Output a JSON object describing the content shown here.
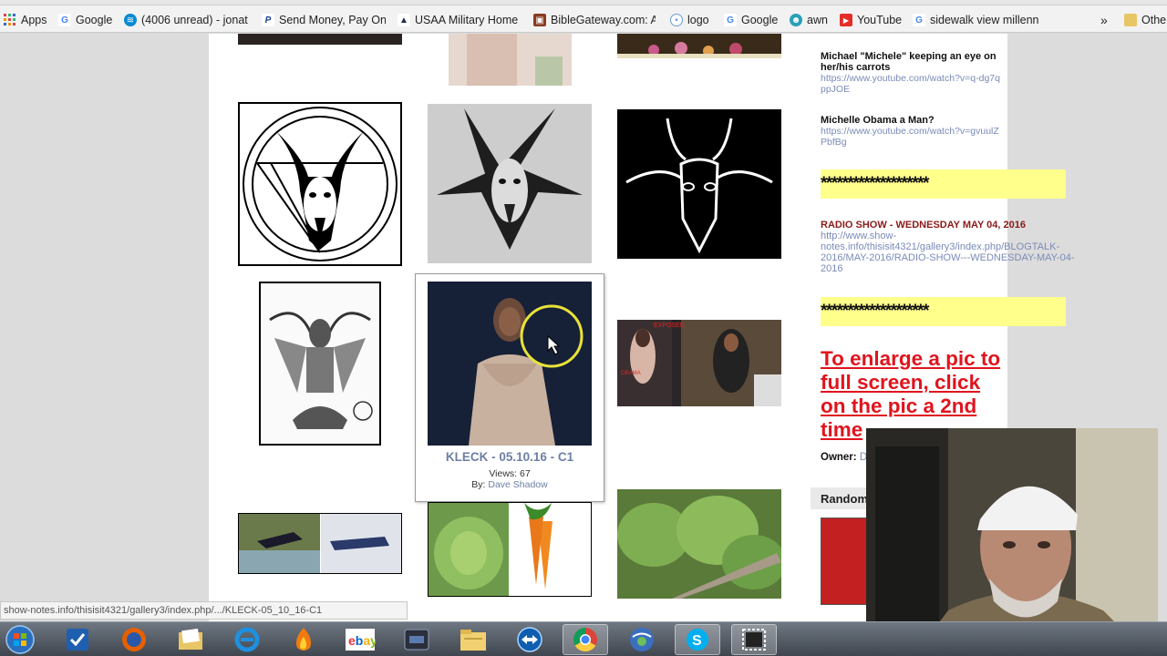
{
  "bookmarks": {
    "apps_label": "Apps",
    "items": [
      {
        "label": "Google",
        "icon": "google-icon"
      },
      {
        "label": "(4006 unread) - jonat",
        "icon": "att-icon"
      },
      {
        "label": "Send Money, Pay Onl",
        "icon": "paypal-icon"
      },
      {
        "label": "USAA Military Home",
        "icon": "usaa-icon"
      },
      {
        "label": "BibleGateway.com: A",
        "icon": "biblegateway-icon"
      },
      {
        "label": "logo",
        "icon": "logo-icon"
      },
      {
        "label": "Google",
        "icon": "google-icon"
      },
      {
        "label": "awn",
        "icon": "awn-icon"
      },
      {
        "label": "YouTube",
        "icon": "youtube-icon"
      },
      {
        "label": "sidewalk view millenn",
        "icon": "google-icon"
      }
    ],
    "more": "»",
    "other_label": "Othe"
  },
  "gallery": {
    "popup": {
      "title": "KLECK - 05.10.16 - C1",
      "views": "Views: 67",
      "by_prefix": "By:",
      "by_name": "Dave Shadow"
    }
  },
  "sidebar": {
    "item1_title": "Michael \"Michele\" keeping an eye on her/his carrots",
    "item1_link": "https://www.youtube.com/watch?v=q-dg7qppJOE",
    "item2_title": "Michelle Obama a Man?",
    "item2_link": "https://www.youtube.com/watch?v=gvuulZPbfBg",
    "stars": "********************",
    "radio_title": "RADIO SHOW - WEDNESDAY MAY 04, 2016",
    "radio_link": "http://www.show-notes.info/thisisit4321/gallery3/index.php/BLOGTALK-2016/MAY-2016/RADIO-SHOW---WEDNESDAY-MAY-04-2016",
    "enlarge": "To enlarge a pic to full screen, click on the pic a 2nd time",
    "owner_label": "Owner:",
    "owner_value": "D",
    "random_label": "Random"
  },
  "thumb_text": {
    "exposed_label": "EXPOSED",
    "obama_label": "OBAMA"
  },
  "status_bar": "show-notes.info/thisisit4321/gallery3/index.php/.../KLECK-05_10_16-C1",
  "taskbar": {
    "items": [
      "start-orb-icon",
      "task-icon",
      "firefox-icon",
      "folder-icon",
      "internet-explorer-icon",
      "flame-icon",
      "ebay-icon",
      "media-icon",
      "file-explorer-icon",
      "teamviewer-icon",
      "chrome-icon",
      "google-earth-icon",
      "skype-icon",
      "snipping-tool-icon"
    ]
  }
}
